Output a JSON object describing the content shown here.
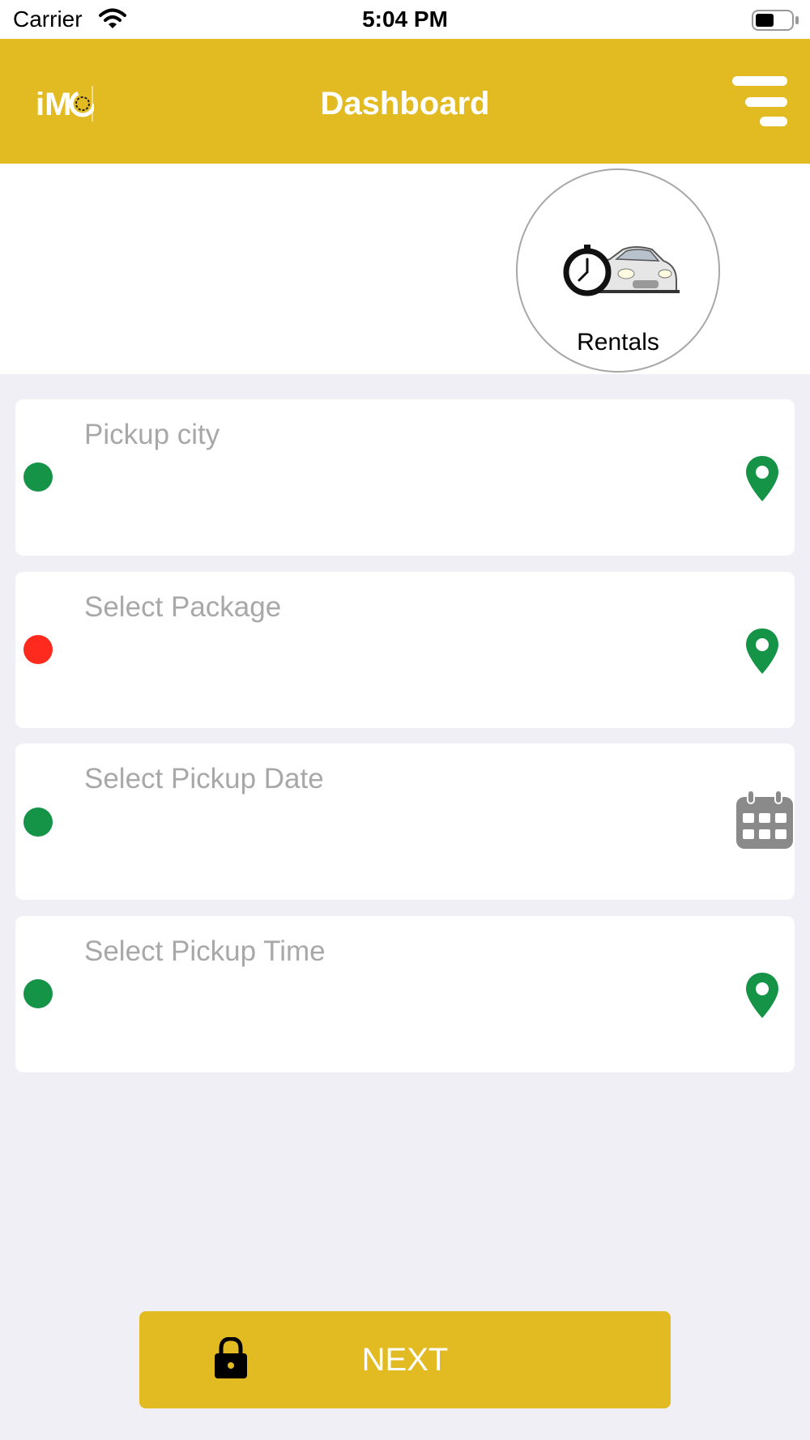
{
  "status_bar": {
    "carrier": "Carrier",
    "time": "5:04 PM"
  },
  "header": {
    "logo_text": "iM",
    "title": "Dashboard",
    "menu_icon": "menu-icon"
  },
  "service": {
    "label": "Rentals",
    "icon": "car-clock-icon"
  },
  "fields": [
    {
      "placeholder": "Pickup city",
      "dot_color": "#159447",
      "icon": "location-pin-icon"
    },
    {
      "placeholder": "Select Package",
      "dot_color": "#fe2a1d",
      "icon": "location-pin-icon"
    },
    {
      "placeholder": "Select Pickup Date",
      "dot_color": "#159447",
      "icon": "calendar-icon"
    },
    {
      "placeholder": "Select Pickup Time",
      "dot_color": "#159447",
      "icon": "location-pin-icon"
    }
  ],
  "next_button": {
    "label": "NEXT",
    "icon": "lock-icon"
  },
  "colors": {
    "brand_yellow": "#e2bb22",
    "pin_green": "#159447",
    "background": "#f0eff5"
  }
}
